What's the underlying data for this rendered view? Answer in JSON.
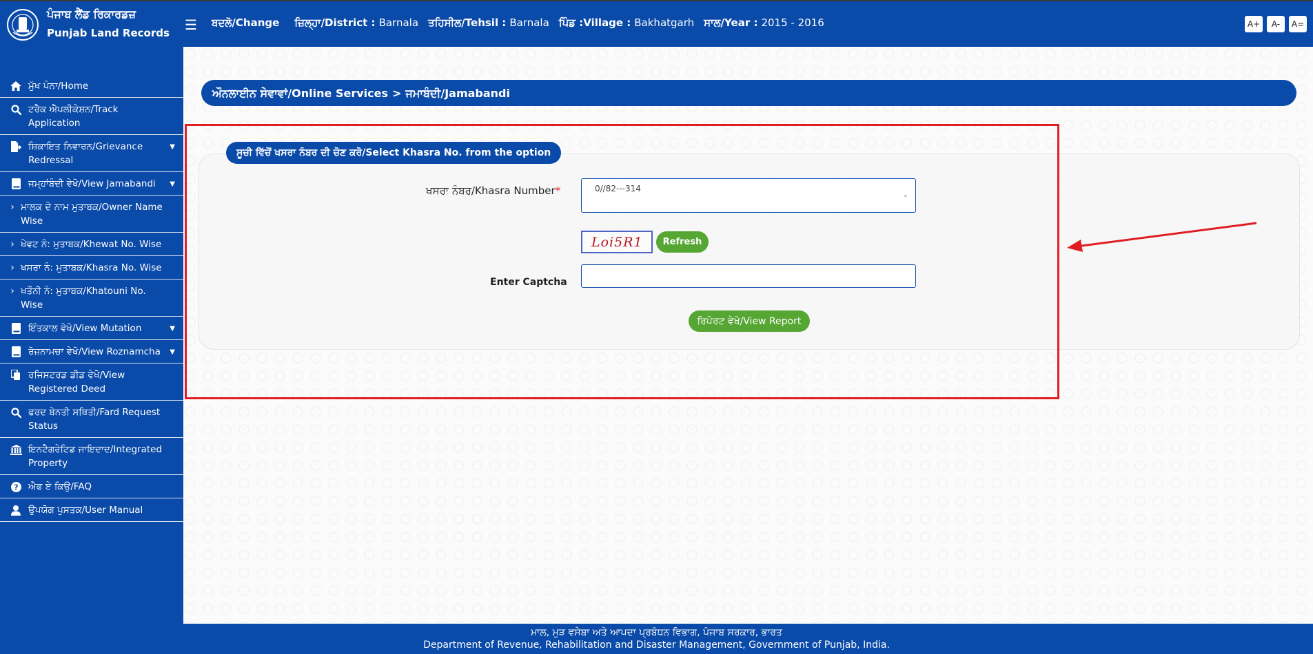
{
  "header": {
    "brand_pa": "ਪੰਜਾਬ ਲੈਂਡ ਰਿਕਾਰਡਜ਼",
    "brand_en": "Punjab Land Records",
    "menu_icon": "hamburger-icon",
    "change_label": "ਬਦਲੋ/Change",
    "district_label": "ਜ਼ਿਲ੍ਹਾ/District :",
    "district_value": "Barnala",
    "tehsil_label": "ਤਹਿਸੀਲ/Tehsil :",
    "tehsil_value": "Barnala",
    "village_label": "ਪਿੰਡ :Village :",
    "village_value": "Bakhatgarh",
    "year_label": "ਸਾਲ/Year :",
    "year_value": "2015 - 2016",
    "font_buttons": [
      "A+",
      "A-",
      "A="
    ]
  },
  "sidebar": {
    "items": [
      {
        "label": "ਮੁੱਖ ਪੰਨਾ/Home",
        "icon": "home-icon"
      },
      {
        "label": "ਟਰੈਕ ਐਪਲੀਕੇਸ਼ਨ/Track Application",
        "icon": "search-icon"
      },
      {
        "label": "ਸ਼ਿਕਾਇਤ ਨਿਵਾਰਨ/Grievance Redressal",
        "icon": "file-export-icon",
        "chevron": "chevron-down-icon"
      },
      {
        "label": "ਜਮ੍ਹਾਂਬੰਦੀ ਵੇਖੋ/View Jamabandi",
        "icon": "book-icon",
        "chevron": "chevron-down-icon"
      },
      {
        "label": "ਮਾਲਕ ਦੇ ਨਾਮ ਮੁਤਾਬਕ/Owner Name Wise",
        "icon": "chevron-right-icon",
        "sub": true
      },
      {
        "label": "ਖੇਵਟ ਨੰ: ਮੁਤਾਬਕ/Khewat No. Wise",
        "icon": "chevron-right-icon",
        "sub": true
      },
      {
        "label": "ਖਸਰਾ ਨੰ: ਮੁਤਾਬਕ/Khasra No. Wise",
        "icon": "chevron-right-icon",
        "sub": true
      },
      {
        "label": "ਖਤੌਨੀ ਨੰ: ਮੁਤਾਬਕ/Khatouni No. Wise",
        "icon": "chevron-right-icon",
        "sub": true
      },
      {
        "label": "ਇੰਤਕਾਲ ਵੇਖੋ/View Mutation",
        "icon": "book-icon",
        "chevron": "chevron-down-icon"
      },
      {
        "label": "ਰੋਜ਼ਨਾਮਚਾ ਵੇਖੋ/View Roznamcha",
        "icon": "book-icon",
        "chevron": "chevron-down-icon"
      },
      {
        "label": "ਰਜਿਸਟਰਡ ਡੀਡ ਵੇਖੋ/View Registered Deed",
        "icon": "copy-icon"
      },
      {
        "label": "ਫਰਦ ਬੇਨਤੀ ਸਥਿਤੀ/Fard Request Status",
        "icon": "search-icon"
      },
      {
        "label": "ਇਨਟੈਗਰੇਟਿਡ ਜਾਇਦਾਦ/Integrated Property",
        "icon": "bank-icon"
      },
      {
        "label": "ਐਫ ਏ ਕਿਉ/FAQ",
        "icon": "question-circle-icon"
      },
      {
        "label": "ਉਪਯੋਗ ਪੁਸਤਕ/User Manual",
        "icon": "user-icon"
      }
    ]
  },
  "main": {
    "breadcrumb": {
      "first": "ਔਨਲਾਈਨ ਸੇਵਾਵਾਂ/Online Services",
      "separator": ">",
      "second": "ਜਮਾਬੰਦੀ/Jamabandi"
    },
    "panel_title": "ਸੂਚੀ ਵਿੱਚੋਂ ਖਸਰਾ ਨੰਬਰ ਦੀ ਚੋਣ ਕਰੋ/Select Khasra No. from the option",
    "khasra_label": "ਖਸਰਾ ਨੰਬਰ/Khasra Number",
    "required_mark": "*",
    "khasra_value": "0//82---314",
    "captcha_text": "Loi5R1",
    "refresh_label": "Refresh",
    "captcha_label": "Enter Captcha",
    "captcha_input_value": "",
    "view_report_label": "ਰਿਪੋਰਟ ਵੇਖੋ/View Report"
  },
  "footer": {
    "line_pa": "ਮਾਲ, ਮੁੜ ਵਸੇਬਾ ਅਤੇ ਆਪਦਾ ਪ੍ਰਬੰਧਨ ਵਿਭਾਗ, ਪੰਜਾਬ ਸਰਕਾਰ, ਭਾਰਤ",
    "line_en": "Department of Revenue, Rehabilitation and Disaster Management, Government of Punjab, India."
  },
  "colors": {
    "brand_blue": "#0a4aa8",
    "button_green": "#55a632",
    "highlight_red": "#e11d24"
  }
}
